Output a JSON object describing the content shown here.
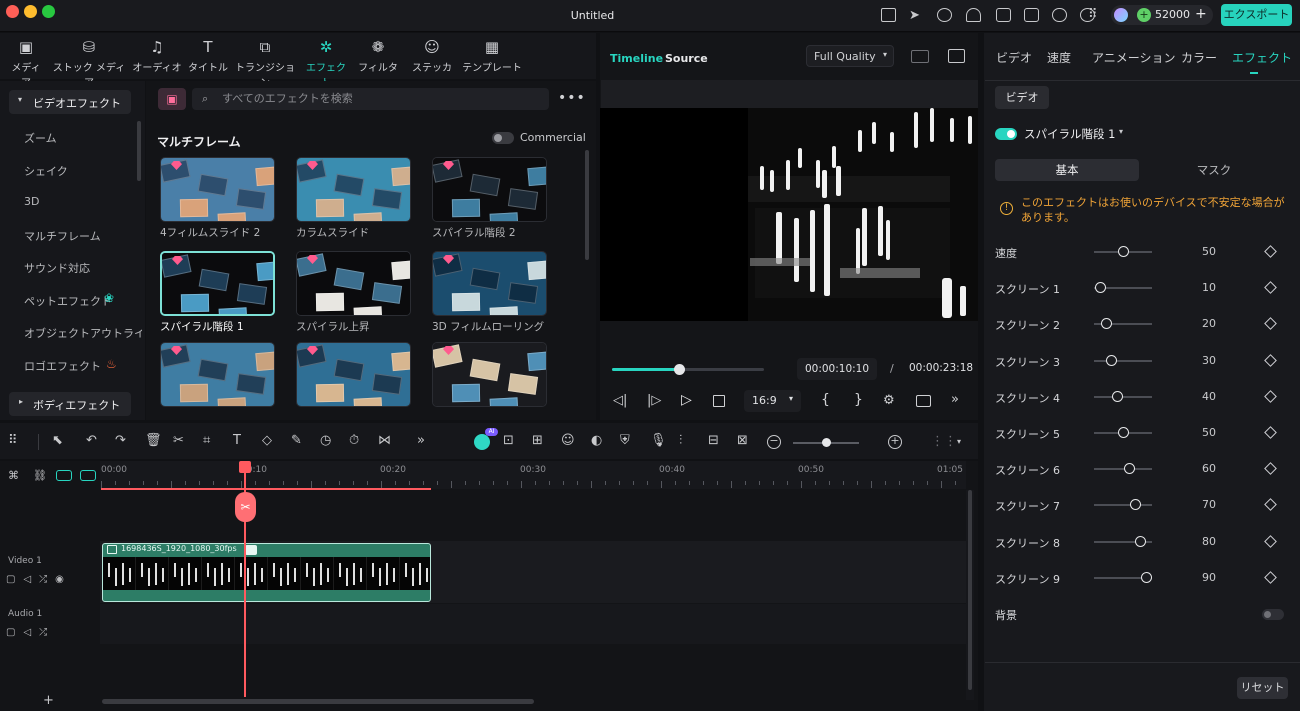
{
  "window": {
    "title": "Untitled"
  },
  "titlebar": {
    "coins": "52000",
    "export_label": "エクスポート"
  },
  "toolbar": {
    "items": [
      {
        "label": "メディア",
        "icon": "media-icon"
      },
      {
        "label": "ストック メディア",
        "icon": "stock-media-icon"
      },
      {
        "label": "オーディオ",
        "icon": "music-note-icon"
      },
      {
        "label": "タイトル",
        "icon": "title-text-icon"
      },
      {
        "label": "トランジション",
        "icon": "transition-icon"
      },
      {
        "label": "エフェクト",
        "icon": "sparkle-effects-icon"
      },
      {
        "label": "フィルター",
        "icon": "filter-icon"
      },
      {
        "label": "ステッカー",
        "icon": "sticker-icon"
      },
      {
        "label": "テンプレート",
        "icon": "template-icon"
      }
    ],
    "active_index": 5
  },
  "sidebar": {
    "header": "ビデオエフェクト",
    "items": [
      "ズーム",
      "シェイク",
      "3D",
      "マルチフレーム",
      "サウンド対応",
      "ペットエフェクト",
      "オブジェクトアウトライン",
      "ロゴエフェクト"
    ],
    "footer": "ボディエフェクト"
  },
  "library": {
    "search_placeholder": "すべてのエフェクトを検索",
    "section_title": "マルチフレーム",
    "commercial_label": "Commercial",
    "effects": [
      {
        "label": "4フィルムスライド 2",
        "colors": [
          "#4a7fa8",
          "#d9a27a",
          "#2d4e6e"
        ]
      },
      {
        "label": "カラムスライド",
        "colors": [
          "#3a8db0",
          "#cfae8e",
          "#234a66"
        ]
      },
      {
        "label": "スパイラル階段 2",
        "colors": [
          "#0c0c0e",
          "#3e7da0",
          "#1d2a36"
        ]
      },
      {
        "label": "スパイラル階段 1",
        "colors": [
          "#0b0b0d",
          "#4a9bc4",
          "#1e3d56"
        ]
      },
      {
        "label": "スパイラル上昇",
        "colors": [
          "#0b0b0d",
          "#e8e6e1",
          "#3b6e8e"
        ]
      },
      {
        "label": "3D フィルムローリング",
        "colors": [
          "#1b4d6e",
          "#c8d8dc",
          "#0f2d44"
        ]
      },
      {
        "label": "",
        "colors": [
          "#3f7da3",
          "#c9a27e",
          "#213f58"
        ]
      },
      {
        "label": "",
        "colors": [
          "#2f6f95",
          "#d7b690",
          "#1c3a52"
        ]
      },
      {
        "label": "",
        "colors": [
          "#1a1b1f",
          "#4f8fb6",
          "#d6c3a5"
        ]
      }
    ],
    "selected_index": 3
  },
  "preview": {
    "tab_timeline": "Timeline",
    "tab_source": "Source",
    "quality": "Full Quality",
    "current_time": "00:00:10:10",
    "separator": "/",
    "total_time": "00:00:23:18",
    "aspect": "16:9",
    "progress": 0.44
  },
  "inspector": {
    "tabs": [
      "ビデオ",
      "速度",
      "アニメーション",
      "カラー",
      "エフェクト"
    ],
    "active_tab": 4,
    "subtab": "ビデオ",
    "effect_name": "スパイラル階段 1",
    "seg_basic": "基本",
    "seg_mask": "マスク",
    "warning": "このエフェクトはお使いのデバイスで不安定な場合があります。",
    "params": [
      {
        "label": "速度",
        "value": 50
      },
      {
        "label": "スクリーン 1",
        "value": 10
      },
      {
        "label": "スクリーン 2",
        "value": 20
      },
      {
        "label": "スクリーン 3",
        "value": 30
      },
      {
        "label": "スクリーン 4",
        "value": 40
      },
      {
        "label": "スクリーン 5",
        "value": 50
      },
      {
        "label": "スクリーン 6",
        "value": 60
      },
      {
        "label": "スクリーン 7",
        "value": 70
      },
      {
        "label": "スクリーン 8",
        "value": 80
      },
      {
        "label": "スクリーン 9",
        "value": 90
      }
    ],
    "background_label": "背景",
    "reset_label": "リセット"
  },
  "timeline": {
    "ruler": [
      "00:00",
      "00:10",
      "00:20",
      "00:30",
      "00:40",
      "00:50",
      "01:05"
    ],
    "video_track": "Video 1",
    "audio_track": "Audio 1",
    "clip_name": "1698436S_1920_1080_30fps",
    "zoom": 0.5
  },
  "colors": {
    "accent": "#28d5c0",
    "playhead": "#ff5a5f",
    "clip": "#2d7d66"
  }
}
